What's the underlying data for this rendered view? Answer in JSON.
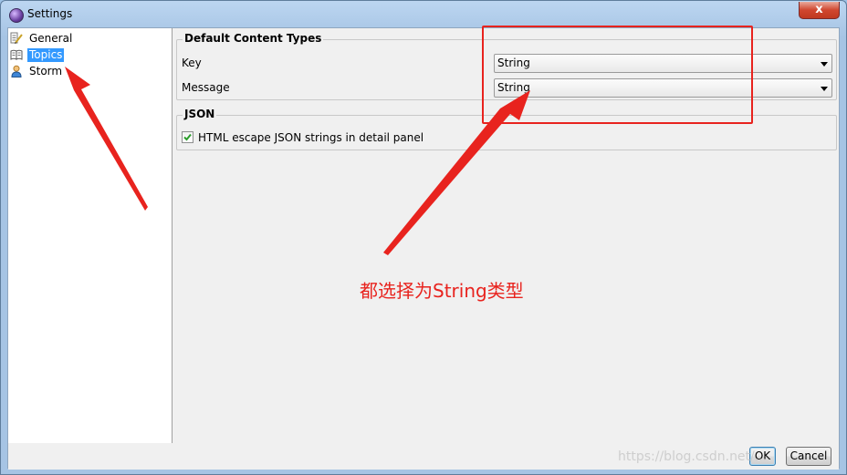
{
  "window": {
    "title": "Settings",
    "close_glyph": "x"
  },
  "tree": {
    "items": [
      {
        "label": "General",
        "icon": "pencil-properties-icon",
        "selected": false
      },
      {
        "label": "Topics",
        "icon": "book-icon",
        "selected": true
      },
      {
        "label": "Storm",
        "icon": "person-icon",
        "selected": false
      }
    ]
  },
  "content_types": {
    "title": "Default Content Types",
    "key_label": "Key",
    "key_value": "String",
    "message_label": "Message",
    "message_value": "String"
  },
  "json": {
    "title": "JSON",
    "escape_label": "HTML escape JSON strings in detail panel",
    "escape_checked": true
  },
  "buttons": {
    "ok": "OK",
    "cancel": "Cancel"
  },
  "annotation": {
    "text": "都选择为String类型",
    "color": "#e8231e"
  },
  "watermark": {
    "text": "https://blog.csdn.net/..."
  },
  "colors": {
    "selection": "#3399ff",
    "annotation_red": "#e8231e"
  }
}
